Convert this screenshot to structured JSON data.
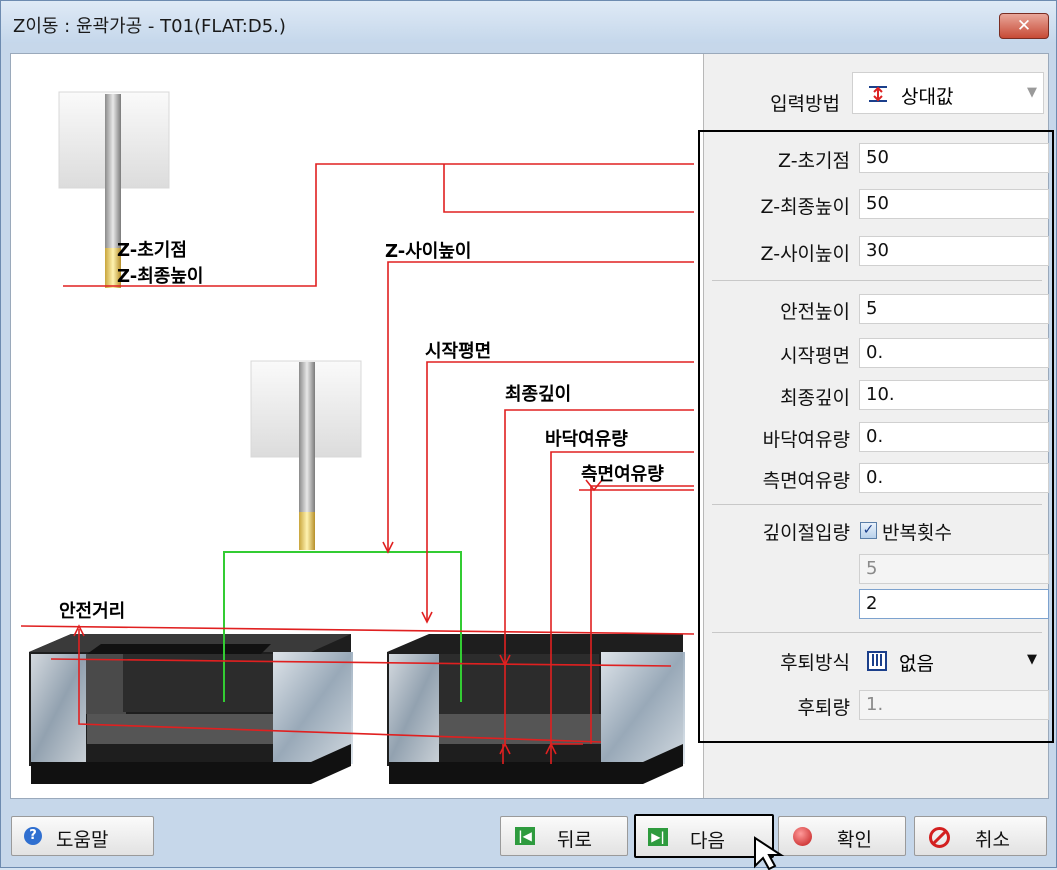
{
  "window": {
    "title": "Z이동 : 윤곽가공 - T01(FLAT:D5.)",
    "close_label": "✕"
  },
  "illustration_labels": {
    "z_initial": "Z-초기점",
    "z_final_height": "Z-최종높이",
    "z_between_height": "Z-사이높이",
    "start_plane": "시작평면",
    "final_depth": "최종깊이",
    "floor_allowance": "바닥여유량",
    "side_allowance": "측면여유량",
    "safe_distance": "안전거리"
  },
  "panel": {
    "input_method": {
      "label": "입력방법",
      "value": "상대값"
    },
    "fields": [
      {
        "label": "Z-초기점",
        "value": "50"
      },
      {
        "label": "Z-최종높이",
        "value": "50"
      },
      {
        "label": "Z-사이높이",
        "value": "30"
      },
      {
        "label": "안전높이",
        "value": "5"
      },
      {
        "label": "시작평면",
        "value": "0."
      },
      {
        "label": "최종깊이",
        "value": "10."
      },
      {
        "label": "바닥여유량",
        "value": "0."
      },
      {
        "label": "측면여유량",
        "value": "0."
      }
    ],
    "depth_cut": {
      "label": "깊이절입량",
      "checkbox_label": "반복횟수",
      "checked": true,
      "value_disabled": "5",
      "value": "2"
    },
    "retract_method": {
      "label": "후퇴방식",
      "value": "없음"
    },
    "retract_amount": {
      "label": "후퇴량",
      "value": "1."
    }
  },
  "buttons": {
    "help": "도움말",
    "back": "뒤로",
    "next": "다음",
    "ok": "확인",
    "cancel": "취소"
  },
  "icons": {
    "help": "help-icon",
    "back": "back-icon",
    "next": "next-icon",
    "ok": "ok-icon",
    "cancel": "cancel-icon",
    "input_method": "relative-value-icon",
    "retract": "retract-icon"
  },
  "colors": {
    "path_line": "#e02020",
    "tool_path": "#33cc33",
    "highlight_box": "#000000"
  }
}
